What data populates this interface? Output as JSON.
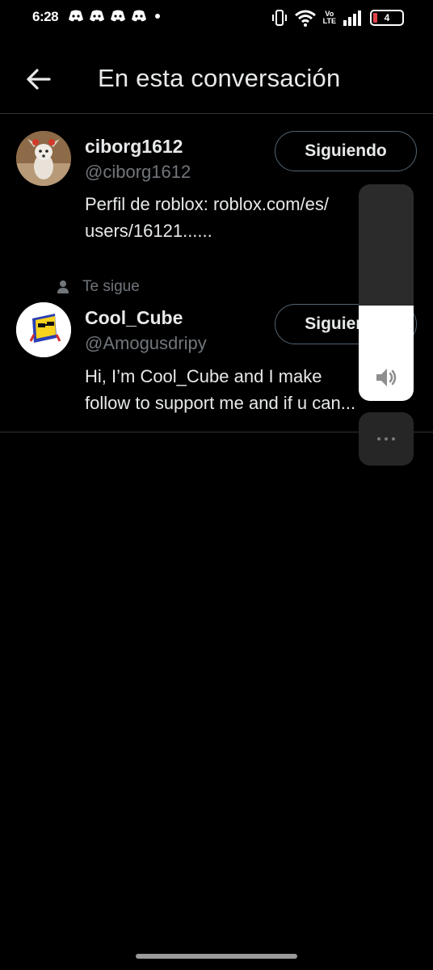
{
  "status_bar": {
    "time": "6:28",
    "volte_top": "Vo",
    "volte_bottom": "LTE",
    "battery": "4",
    "notification_icons": [
      "discord-icon",
      "discord-icon",
      "discord-icon",
      "discord-icon"
    ]
  },
  "header": {
    "title": "En esta conversación",
    "back_icon": "arrow-left-icon"
  },
  "users": [
    {
      "name": "ciborg1612",
      "handle": "@ciborg1612",
      "bio": "Perfil de roblox: roblox.com/es/\nusers/16121......",
      "follow_label": "Siguiendo",
      "follows_you": ""
    },
    {
      "name": "Cool_Cube",
      "handle": "@Amogusdripy",
      "bio": "Hi, I’m Cool_Cube and I make\nfollow to support me and if u can...",
      "follow_label": "Siguiendo",
      "follows_you": "Te sigue"
    }
  ],
  "volume": {
    "level": 0.44,
    "icon": "speaker-icon"
  },
  "colors": {
    "background": "#000000",
    "text": "#e7e9ea",
    "secondary_text": "#71767b",
    "divider": "#2f3336",
    "button_border": "#536471"
  }
}
